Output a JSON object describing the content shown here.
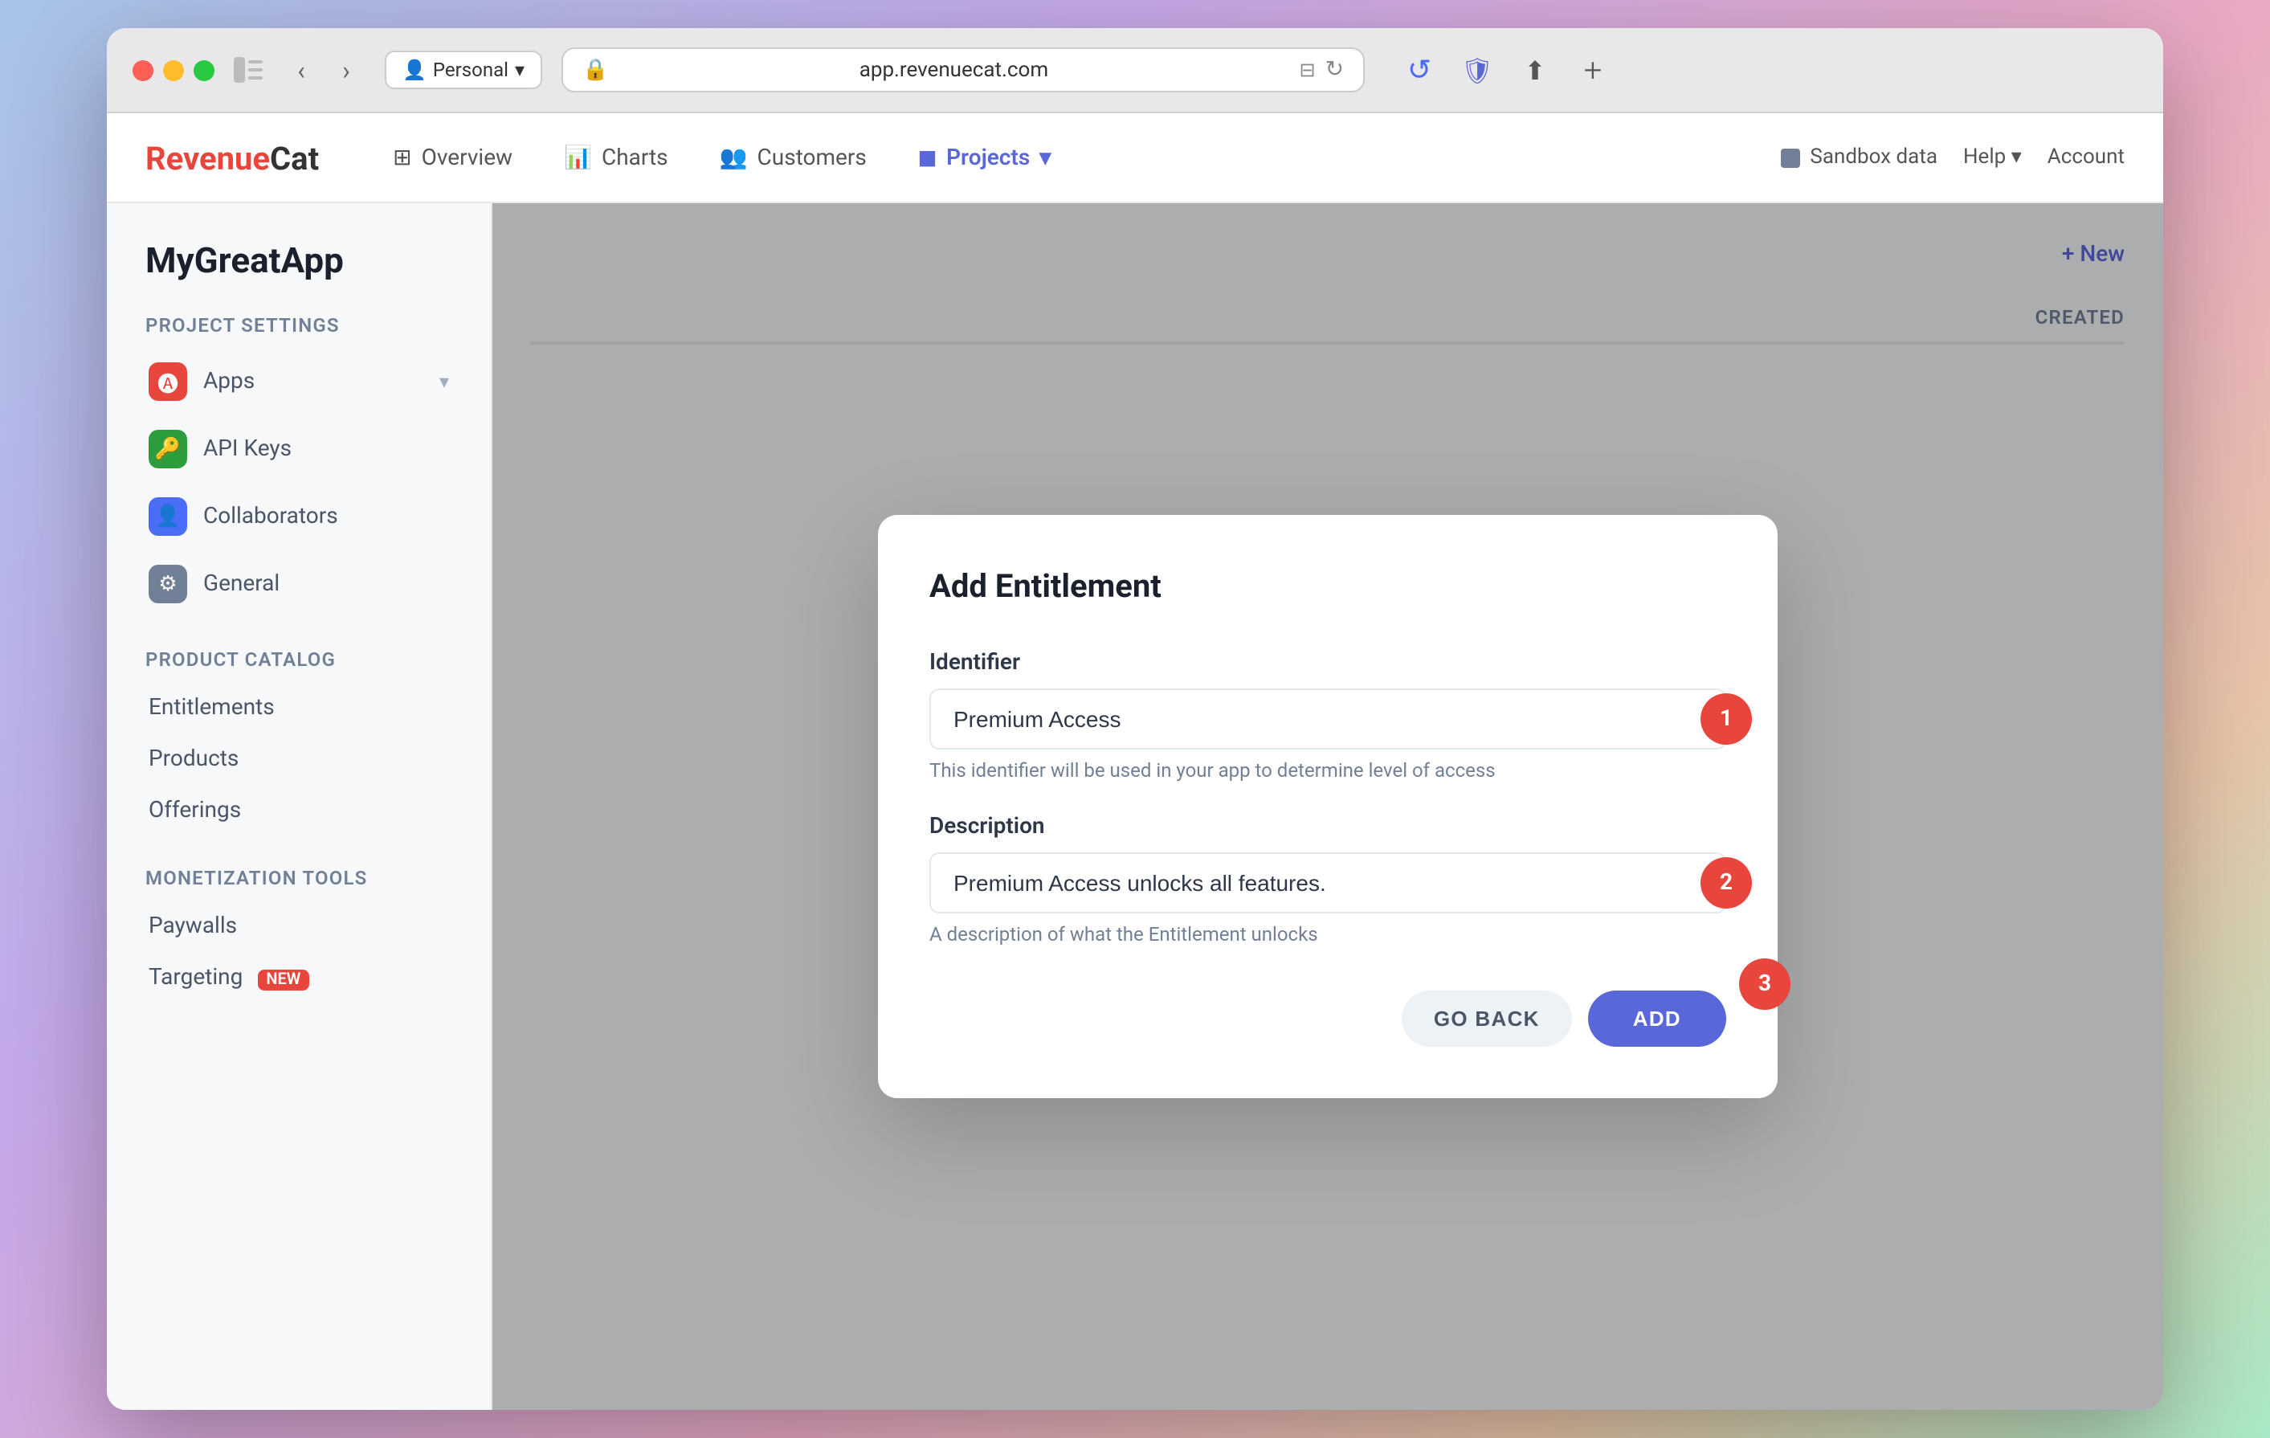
{
  "browser": {
    "url": "app.revenuecat.com",
    "profile": "Personal",
    "profile_icon": "👤"
  },
  "nav": {
    "logo_revenue": "Revenue",
    "logo_cat": "Cat",
    "items": [
      {
        "label": "Overview",
        "icon": "⊞",
        "active": false
      },
      {
        "label": "Charts",
        "icon": "📊",
        "active": false
      },
      {
        "label": "Customers",
        "icon": "👥",
        "active": false
      },
      {
        "label": "Projects",
        "icon": "◼",
        "active": true
      }
    ],
    "sandbox_label": "Sandbox data",
    "help_label": "Help",
    "account_label": "Account"
  },
  "page": {
    "title": "MyGreatApp"
  },
  "sidebar": {
    "project_settings_title": "Project settings",
    "apps_label": "Apps",
    "api_keys_label": "API Keys",
    "collaborators_label": "Collaborators",
    "general_label": "General",
    "product_catalog_title": "Product catalog",
    "entitlements_label": "Entitlements",
    "products_label": "Products",
    "offerings_label": "Offerings",
    "monetization_title": "Monetization tools",
    "paywalls_label": "Paywalls",
    "targeting_label": "Targeting",
    "targeting_new_badge": "NEW"
  },
  "main": {
    "new_button": "+ New",
    "table_created_col": "Created"
  },
  "modal": {
    "title": "Add Entitlement",
    "identifier_label": "Identifier",
    "identifier_value": "Premium Access",
    "identifier_hint": "This identifier will be used in your app to determine level of access",
    "description_label": "Description",
    "description_value": "Premium Access unlocks all features.",
    "description_hint": "A description of what the Entitlement unlocks",
    "go_back_label": "GO BACK",
    "add_label": "ADD",
    "step1": "1",
    "step2": "2",
    "step3": "3"
  }
}
